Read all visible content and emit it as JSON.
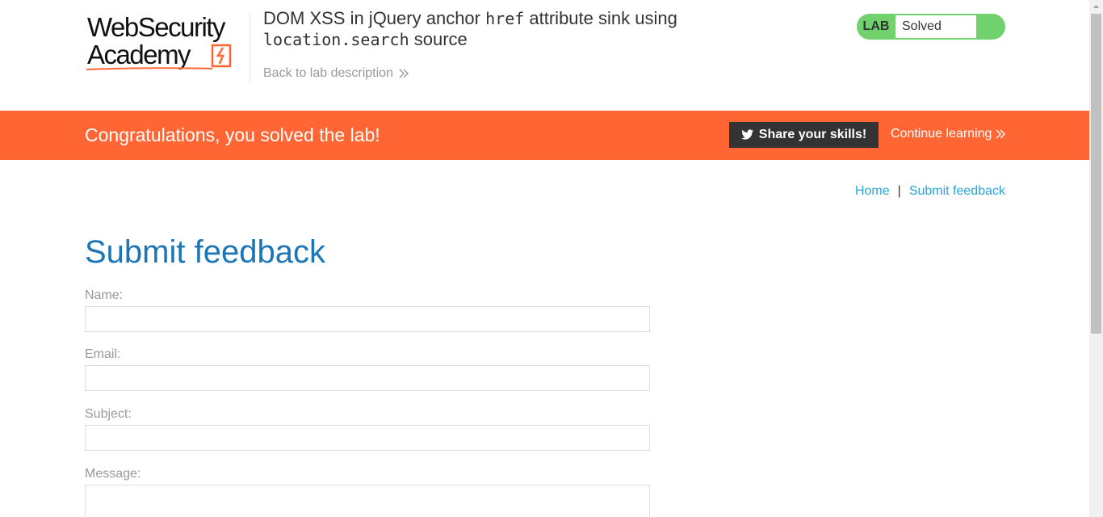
{
  "header": {
    "logo_line1": "WebSecurity",
    "logo_line2": "Academy",
    "lab_title_part1": "DOM XSS in jQuery anchor ",
    "lab_title_code1": "href",
    "lab_title_part2": " attribute sink using ",
    "lab_title_code2": "location.search",
    "lab_title_part3": " source",
    "back_link": "Back to lab description",
    "status_badge": "LAB",
    "status_text": "Solved"
  },
  "banner": {
    "message": "Congratulations, you solved the lab!",
    "share_label": "Share your skills!",
    "continue_label": "Continue learning"
  },
  "nav": {
    "home": "Home",
    "separator": "|",
    "submit_feedback": "Submit feedback"
  },
  "form": {
    "title": "Submit feedback",
    "name_label": "Name:",
    "email_label": "Email:",
    "subject_label": "Subject:",
    "message_label": "Message:"
  },
  "colors": {
    "accent_orange": "#ff6633",
    "status_green": "#70d16d",
    "link_blue": "#29a3d9",
    "title_blue": "#1a76b7"
  },
  "icons": [
    "logo-bolt-icon",
    "chevron-double-right-icon",
    "twitter-icon"
  ]
}
